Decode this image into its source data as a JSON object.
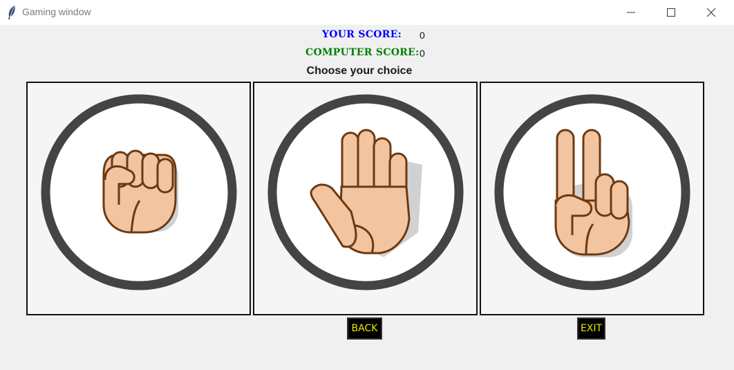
{
  "window": {
    "title": "Gaming window",
    "icons": {
      "app": "feather-icon",
      "minimize": "minimize-icon",
      "maximize": "maximize-icon",
      "close": "close-icon"
    }
  },
  "scores": {
    "your_label": "YOUR SCORE:",
    "your_value": "0",
    "your_color": "#0000ff",
    "computer_label": "COMPUTER SCORE:",
    "computer_value": "0",
    "computer_color": "#008000"
  },
  "prompt": "Choose your choice",
  "choices": [
    {
      "id": "rock",
      "icon": "rock-fist-hand-icon"
    },
    {
      "id": "paper",
      "icon": "paper-open-hand-icon"
    },
    {
      "id": "scissors",
      "icon": "scissors-peace-hand-icon"
    }
  ],
  "buttons": {
    "back_label": "BACK",
    "exit_label": "EXIT",
    "text_color": "#e6e600",
    "background": "#000000"
  }
}
